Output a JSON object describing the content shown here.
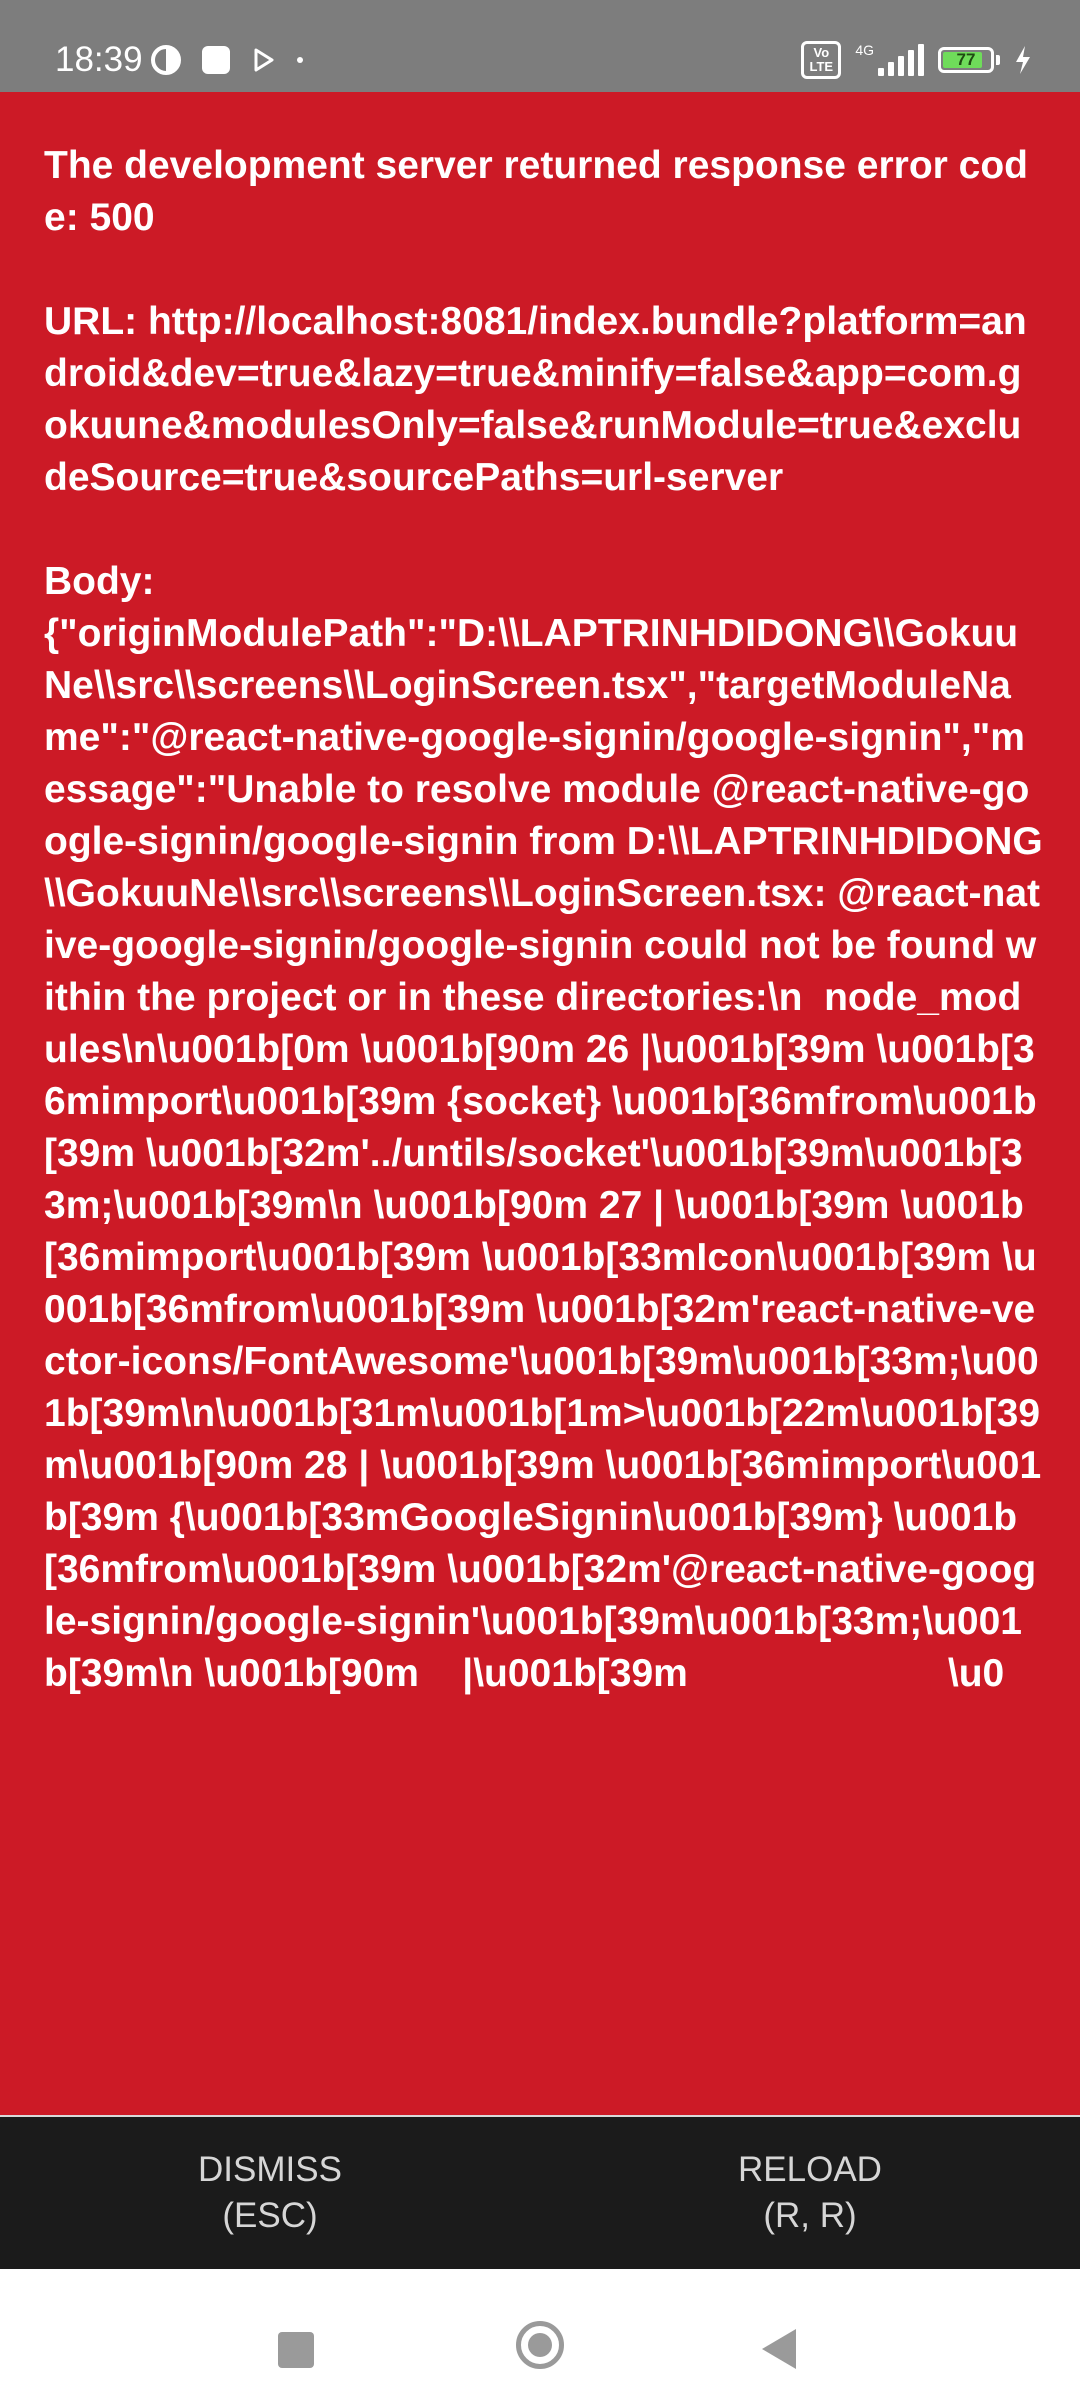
{
  "status_bar": {
    "time": "18:39",
    "network_type": "4G",
    "volte_label": "Vo\nLTE",
    "battery_level": "77",
    "icons": [
      "activity-icon",
      "notification-square-icon",
      "play-icon",
      "dot-icon",
      "volte-icon",
      "signal-icon",
      "battery-icon",
      "charging-icon"
    ]
  },
  "error": {
    "message": "The development server returned response error code: 500\n\nURL: http://localhost:8081/index.bundle?platform=android&dev=true&lazy=true&minify=false&app=com.gokuune&modulesOnly=false&runModule=true&excludeSource=true&sourcePaths=url-server\n\nBody:\n{\"originModulePath\":\"D:\\\\LAPTRINHDIDONG\\\\GokuuNe\\\\src\\\\screens\\\\LoginScreen.tsx\",\"targetModuleName\":\"@react-native-google-signin/google-signin\",\"message\":\"Unable to resolve module @react-native-google-signin/google-signin from D:\\\\LAPTRINHDIDONG\\\\GokuuNe\\\\src\\\\screens\\\\LoginScreen.tsx: @react-native-google-signin/google-signin could not be found within the project or in these directories:\\n  node_modules\\n\\u001b[0m \\u001b[90m 26 |\\u001b[39m \\u001b[36mimport\\u001b[39m {socket} \\u001b[36mfrom\\u001b[39m \\u001b[32m'../untils/socket'\\u001b[39m\\u001b[33m;\\u001b[39m\\n \\u001b[90m 27 | \\u001b[39m \\u001b[36mimport\\u001b[39m \\u001b[33mIcon\\u001b[39m \\u001b[36mfrom\\u001b[39m \\u001b[32m'react-native-vector-icons/FontAwesome'\\u001b[39m\\u001b[33m;\\u001b[39m\\n\\u001b[31m\\u001b[1m>\\u001b[22m\\u001b[39m\\u001b[90m 28 | \\u001b[39m \\u001b[36mimport\\u001b[39m {\\u001b[33mGoogleSignin\\u001b[39m} \\u001b[36mfrom\\u001b[39m \\u001b[32m'@react-native-google-signin/google-signin'\\u001b[39m\\u001b[33m;\\u001b[39m\\n \\u001b[90m    |\\u001b[39m                        \\u0"
  },
  "buttons": {
    "dismiss": "DISMISS\n(ESC)",
    "reload": "RELOAD\n(R, R)"
  },
  "colors": {
    "error_background": "#cc1a26",
    "button_bar": "#1b1b1b",
    "status_bar": "#7d7d7d"
  }
}
